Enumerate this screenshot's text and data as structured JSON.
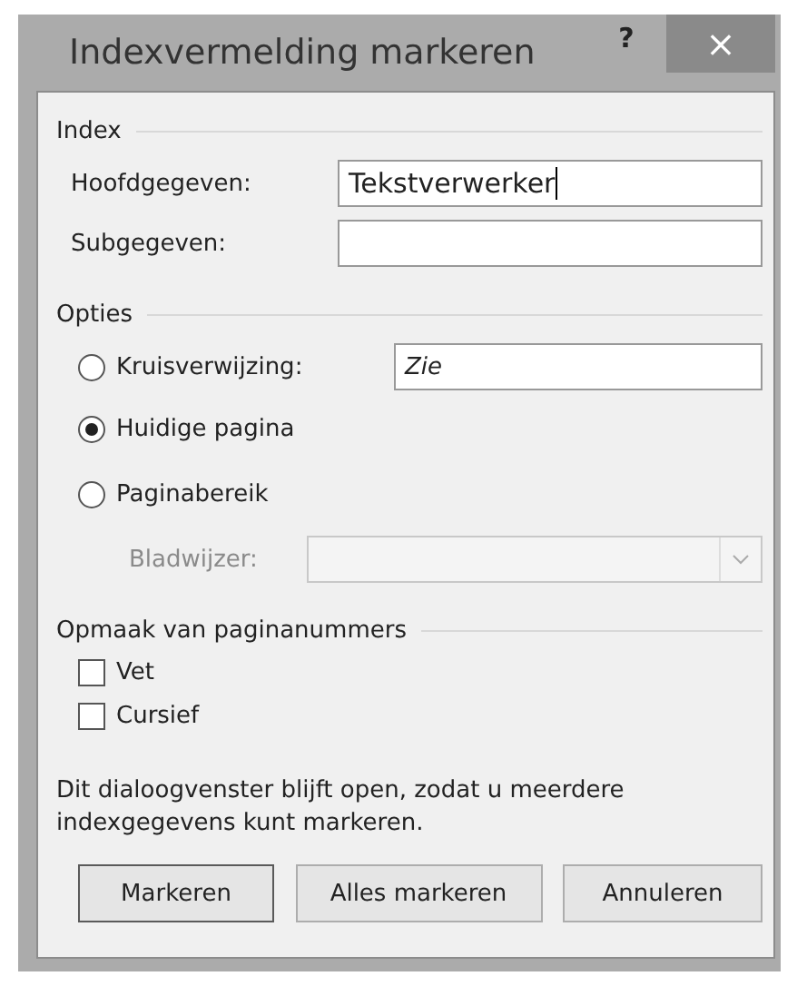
{
  "window": {
    "title": "Indexvermelding markeren",
    "help": "?",
    "close": "×"
  },
  "index": {
    "heading": "Index",
    "fields": [
      {
        "label": "Hoofdgegeven:",
        "value": "Tekstverwerker",
        "caret": true
      },
      {
        "label": "Subgegeven:",
        "caret": false
      }
    ]
  },
  "options": {
    "heading": "Opties",
    "items": [
      {
        "kind": "field",
        "label": "Kruisverwijzing:",
        "selected": false,
        "value": "Zie"
      },
      {
        "kind": "plain",
        "label": "Huidige pagina",
        "selected": true
      },
      {
        "kind": "plain",
        "label": "Paginabereik",
        "selected": false
      }
    ],
    "bookmark": {
      "label": "Bladwijzer:",
      "disabled": true
    }
  },
  "format": {
    "heading": "Opmaak van paginanummers",
    "checks": [
      {
        "label": "Vet",
        "checked": false
      },
      {
        "label": "Cursief",
        "checked": false
      }
    ]
  },
  "note": "Dit dialoogvenster blijft open, zodat u meerdere indexgegevens kunt markeren.",
  "buttons": [
    "Markeren",
    "Alles markeren",
    "Annuleren"
  ]
}
